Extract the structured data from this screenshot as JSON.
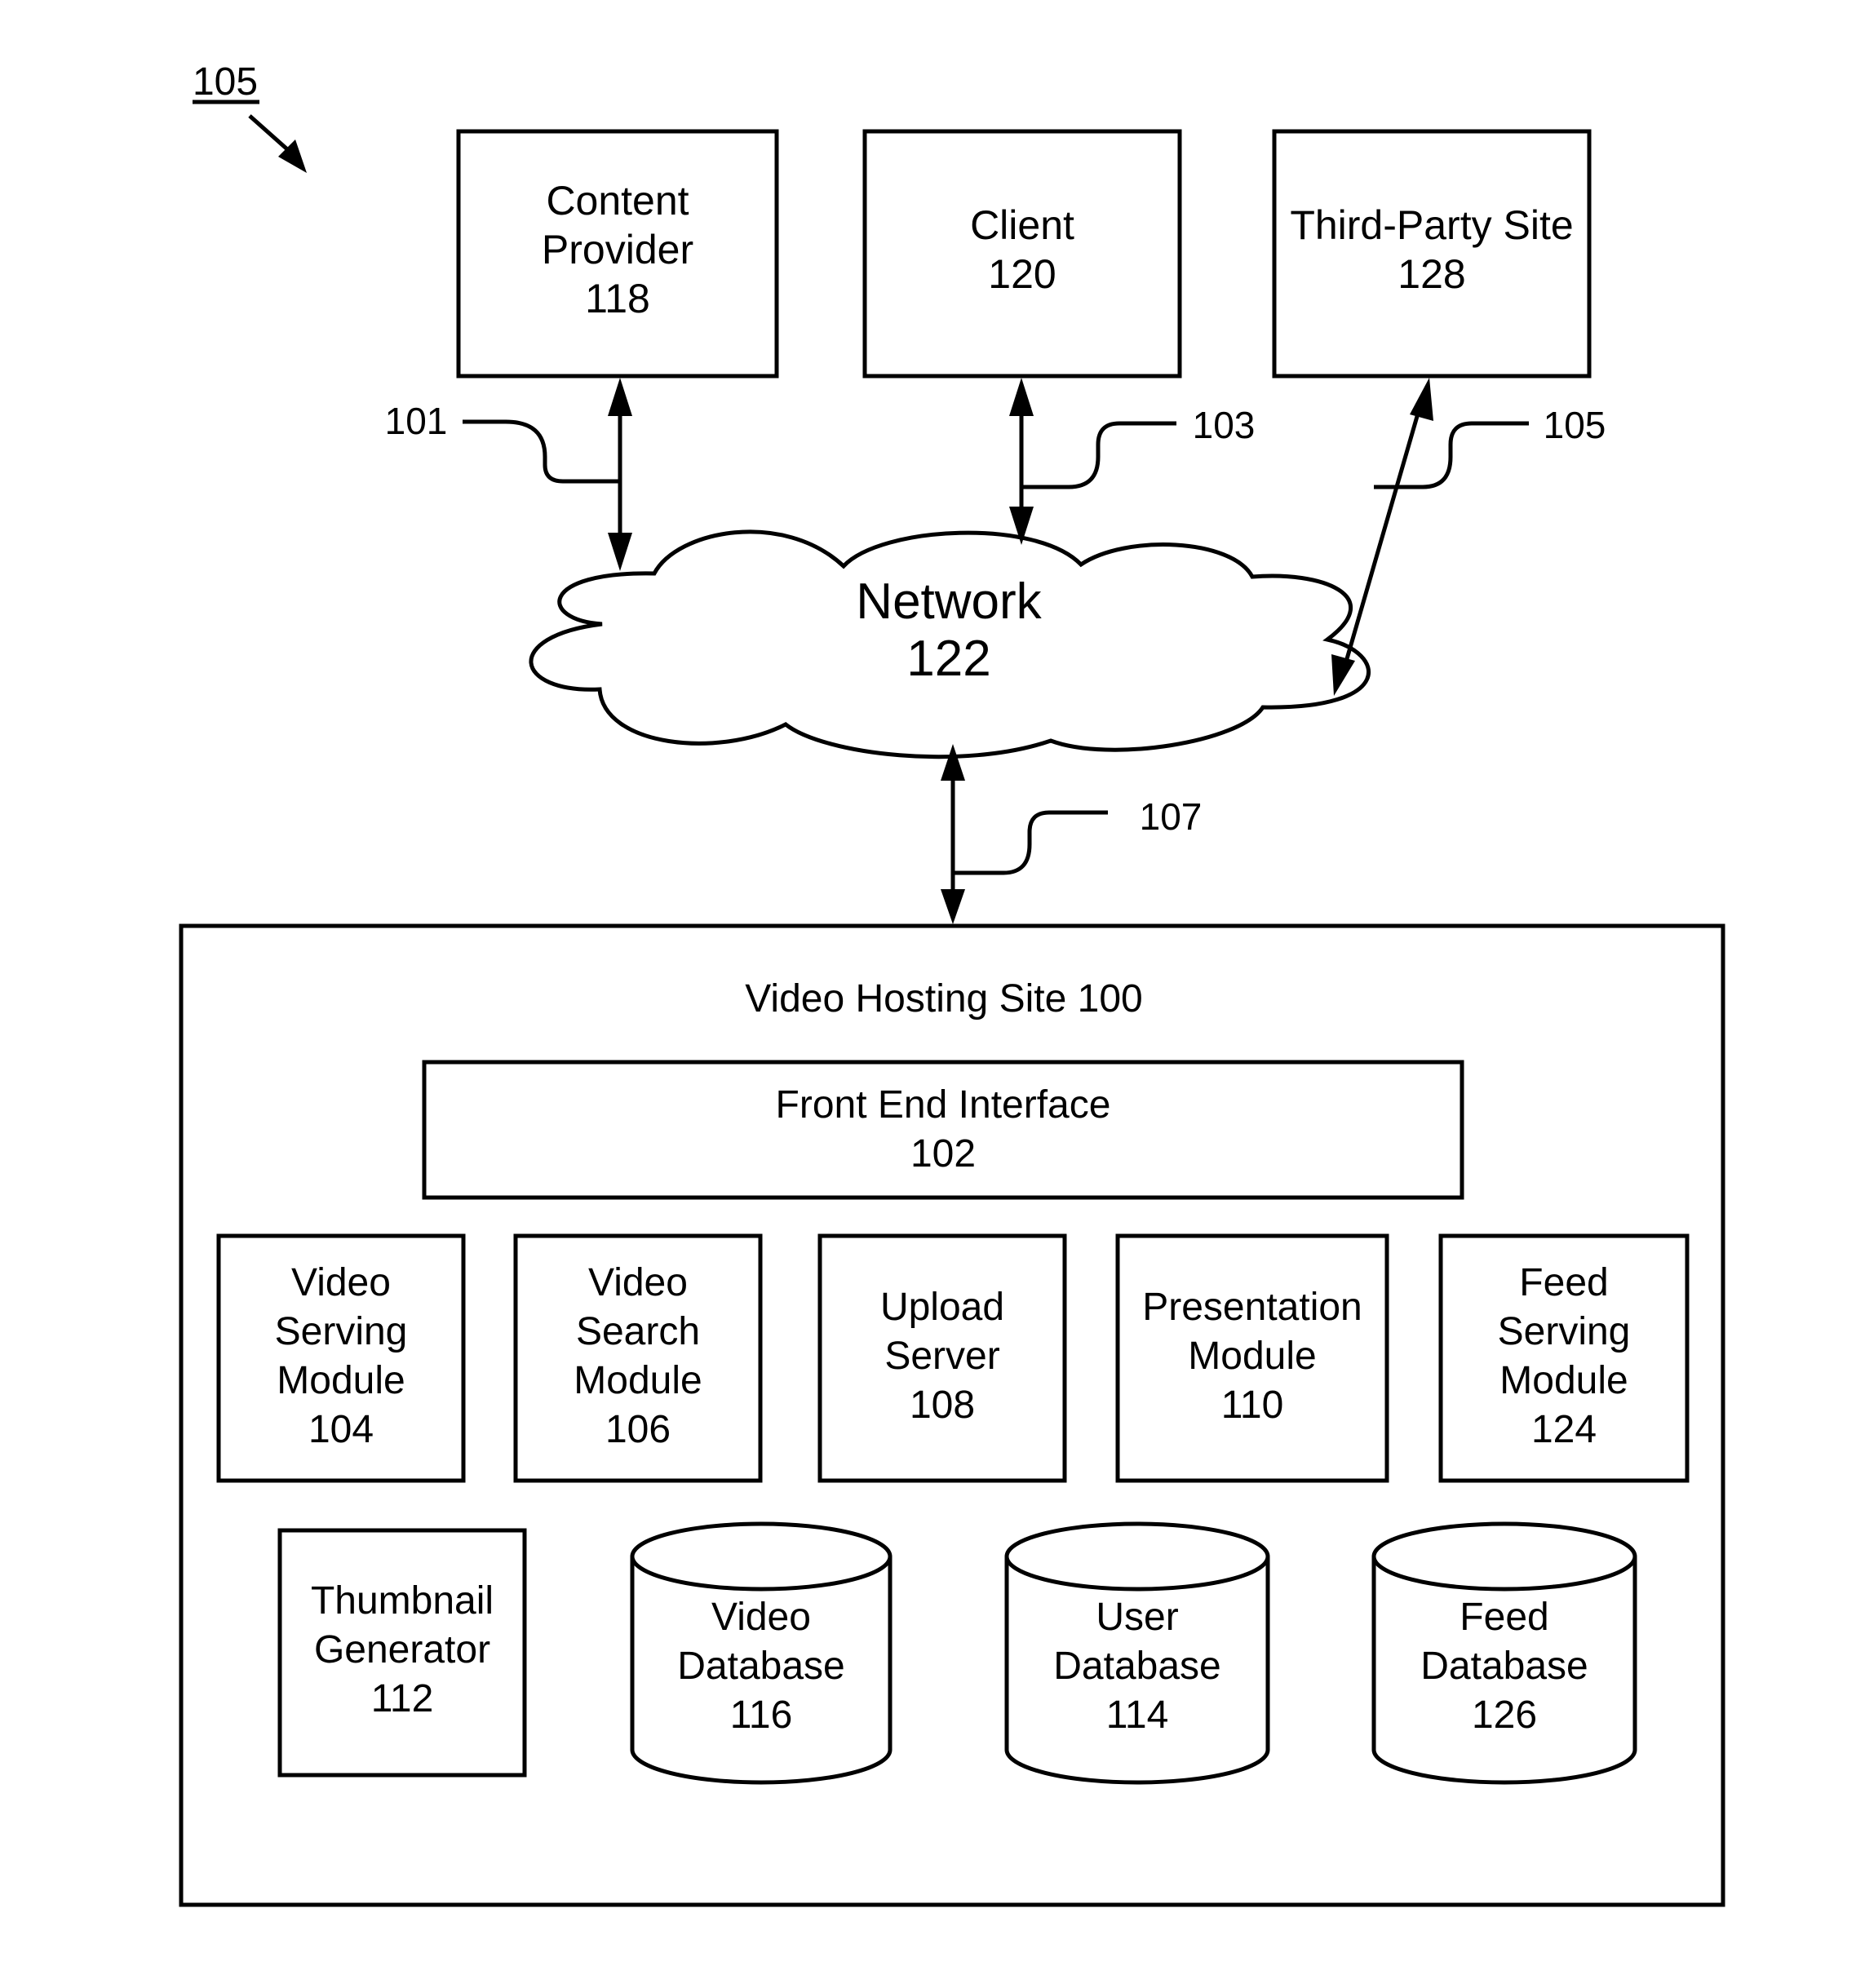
{
  "figure": {
    "reference": "105",
    "external_entities": {
      "content_provider": {
        "lines": [
          "Content",
          "Provider",
          "118"
        ]
      },
      "client": {
        "lines": [
          "Client",
          "120"
        ]
      },
      "third_party_site": {
        "lines": [
          "Third-Party Site",
          "128"
        ]
      }
    },
    "network": {
      "lines": [
        "Network",
        "122"
      ]
    },
    "connections": {
      "content_provider_network": {
        "label": "101",
        "direction": "bidirectional"
      },
      "client_network": {
        "label": "103",
        "direction": "bidirectional"
      },
      "third_party_network": {
        "label": "105",
        "direction": "bidirectional"
      },
      "network_video_hosting": {
        "label": "107",
        "direction": "bidirectional"
      }
    },
    "video_hosting_site": {
      "title": "Video Hosting Site 100",
      "front_end": {
        "lines": [
          "Front End Interface",
          "102"
        ]
      },
      "modules": [
        {
          "id": "video-serving-module",
          "lines": [
            "Video",
            "Serving",
            "Module",
            "104"
          ]
        },
        {
          "id": "video-search-module",
          "lines": [
            "Video",
            "Search",
            "Module",
            "106"
          ]
        },
        {
          "id": "upload-server",
          "lines": [
            "Upload",
            "Server",
            "108"
          ]
        },
        {
          "id": "presentation-module",
          "lines": [
            "Presentation",
            "Module",
            "110"
          ]
        },
        {
          "id": "feed-serving-module",
          "lines": [
            "Feed",
            "Serving",
            "Module",
            "124"
          ]
        }
      ],
      "thumbnail_generator": {
        "lines": [
          "Thumbnail",
          "Generator",
          "112"
        ]
      },
      "databases": [
        {
          "id": "video-database",
          "lines": [
            "Video",
            "Database",
            "116"
          ]
        },
        {
          "id": "user-database",
          "lines": [
            "User",
            "Database",
            "114"
          ]
        },
        {
          "id": "feed-database",
          "lines": [
            "Feed",
            "Database",
            "126"
          ]
        }
      ]
    }
  },
  "colors": {
    "ink": "#000000",
    "paper": "#ffffff"
  }
}
